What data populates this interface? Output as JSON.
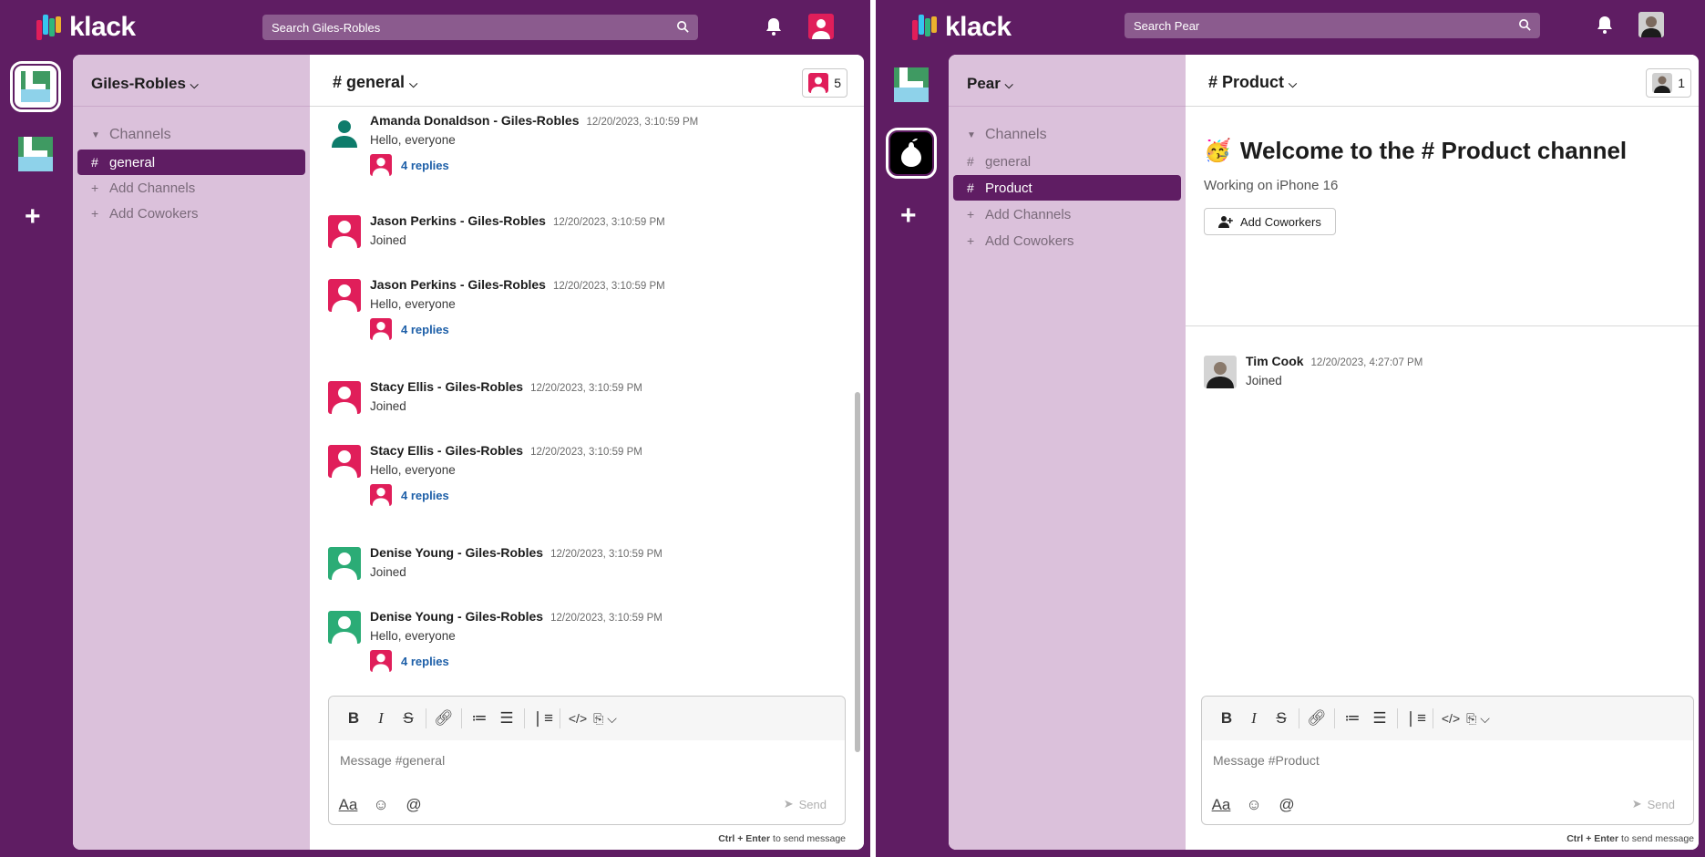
{
  "left": {
    "brand": "klack",
    "search_placeholder": "Search Giles-Robles",
    "workspace_name": "Giles-Robles",
    "channels_label": "Channels",
    "sidebar_items": [
      {
        "label": "general",
        "glyph": "#"
      },
      {
        "label": "Add Channels",
        "glyph": "+"
      },
      {
        "label": "Add Cowokers",
        "glyph": "+"
      }
    ],
    "channel_title": "# general",
    "member_count": "5",
    "messages": [
      {
        "name": "Amanda Donaldson - Giles-Robles",
        "time": "12/20/2023, 3:10:59 PM",
        "text": "Hello, everyone",
        "replies": "4 replies",
        "avatar_color": "#0e7c6b"
      },
      {
        "name": "Jason Perkins - Giles-Robles",
        "time": "12/20/2023, 3:10:59 PM",
        "text": "Joined",
        "replies": "",
        "avatar_color": "#e01e5a"
      },
      {
        "name": "Jason Perkins - Giles-Robles",
        "time": "12/20/2023, 3:10:59 PM",
        "text": "Hello, everyone",
        "replies": "4 replies",
        "avatar_color": "#e01e5a"
      },
      {
        "name": "Stacy Ellis - Giles-Robles",
        "time": "12/20/2023, 3:10:59 PM",
        "text": "Joined",
        "replies": "",
        "avatar_color": "#e01e5a"
      },
      {
        "name": "Stacy Ellis - Giles-Robles",
        "time": "12/20/2023, 3:10:59 PM",
        "text": "Hello, everyone",
        "replies": "4 replies",
        "avatar_color": "#e01e5a"
      },
      {
        "name": "Denise Young - Giles-Robles",
        "time": "12/20/2023, 3:10:59 PM",
        "text": "Joined",
        "replies": "",
        "avatar_color": "#2bac76"
      },
      {
        "name": "Denise Young - Giles-Robles",
        "time": "12/20/2023, 3:10:59 PM",
        "text": "Hello, everyone",
        "replies": "4 replies",
        "avatar_color": "#2bac76"
      }
    ],
    "composer_placeholder": "Message #general",
    "send_label": "Send",
    "hint_keys": "Ctrl + Enter",
    "hint_text": " to send message"
  },
  "right": {
    "brand": "klack",
    "search_placeholder": "Search Pear",
    "workspace_name": "Pear",
    "channels_label": "Channels",
    "sidebar_items": [
      {
        "label": "general",
        "glyph": "#"
      },
      {
        "label": "Product",
        "glyph": "#"
      },
      {
        "label": "Add Channels",
        "glyph": "+"
      },
      {
        "label": "Add Cowokers",
        "glyph": "+"
      }
    ],
    "channel_title": "# Product",
    "member_count": "1",
    "welcome_emoji": "🥳",
    "welcome_title": "Welcome to the # Product channel",
    "welcome_sub": "Working on iPhone 16",
    "add_coworkers_label": "Add Coworkers",
    "messages": [
      {
        "name": "Tim Cook",
        "time": "12/20/2023, 4:27:07 PM",
        "text": "Joined"
      }
    ],
    "composer_placeholder": "Message #Product",
    "send_label": "Send",
    "hint_keys": "Ctrl + Enter",
    "hint_text": " to send message"
  },
  "colors": {
    "purple": "#5f1d63",
    "sidebar": "#dbc1db",
    "link": "#1d5fa8",
    "avatar_pink": "#e01e5a",
    "avatar_green": "#2bac76",
    "avatar_teal": "#0e7c6b"
  }
}
